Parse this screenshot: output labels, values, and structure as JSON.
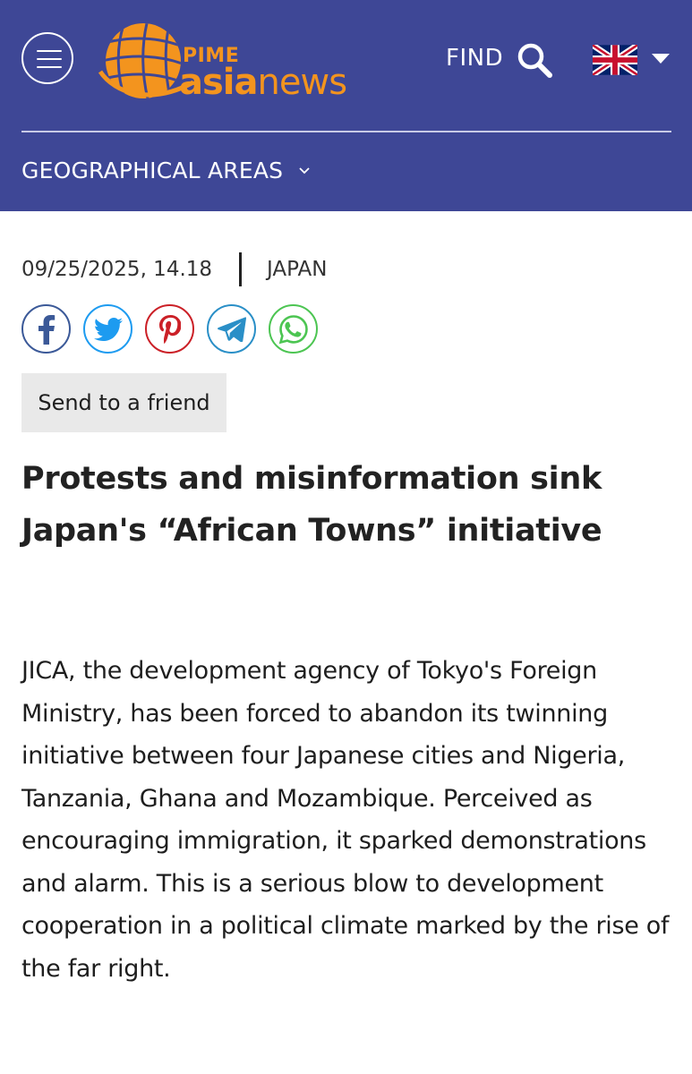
{
  "header": {
    "logo": {
      "top": "PIME",
      "word_bold": "asia",
      "word_light": "news"
    },
    "find_label": "FIND",
    "language": "English",
    "nav_label": "GEOGRAPHICAL AREAS",
    "colors": {
      "background": "#3e4796",
      "brand_orange": "#f3941e"
    }
  },
  "article": {
    "date": "09/25/2025, 14.18",
    "country": "JAPAN",
    "share": [
      "facebook-icon",
      "twitter-icon",
      "pinterest-icon",
      "telegram-icon",
      "whatsapp-icon"
    ],
    "send_label": "Send to a friend",
    "title": "Protests and misinformation sink Japan's “African Towns” initiative",
    "summary": "JICA, the development agency of Tokyo's Foreign Ministry, has been forced to abandon its twinning initiative between four Japanese cities and Nigeria, Tanzania, Ghana and Mozambique. Perceived as encouraging immigration, it sparked demonstrations and alarm. This is a serious blow to development cooperation in a political climate marked by the rise of the far right."
  }
}
